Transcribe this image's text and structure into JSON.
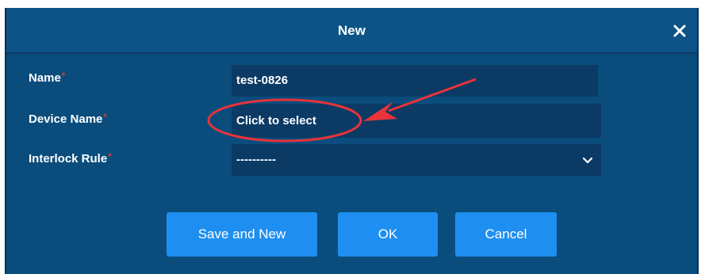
{
  "dialog": {
    "title": "New",
    "close_icon": "close-icon"
  },
  "form": {
    "name": {
      "label": "Name",
      "required_mark": "*",
      "value": "test-0826"
    },
    "device_name": {
      "label": "Device Name",
      "required_mark": "*",
      "value": "Click to select"
    },
    "interlock_rule": {
      "label": "Interlock Rule",
      "required_mark": "*",
      "value": "----------",
      "icon": "chevron-down-icon"
    }
  },
  "buttons": {
    "save_and_new": "Save and New",
    "ok": "OK",
    "cancel": "Cancel"
  },
  "colors": {
    "dialog_bg": "#0a4d7d",
    "field_bg": "#0b3b65",
    "button_bg": "#1e8ff0",
    "required_mark": "#e33b3b",
    "annotation": "#e8333a"
  }
}
